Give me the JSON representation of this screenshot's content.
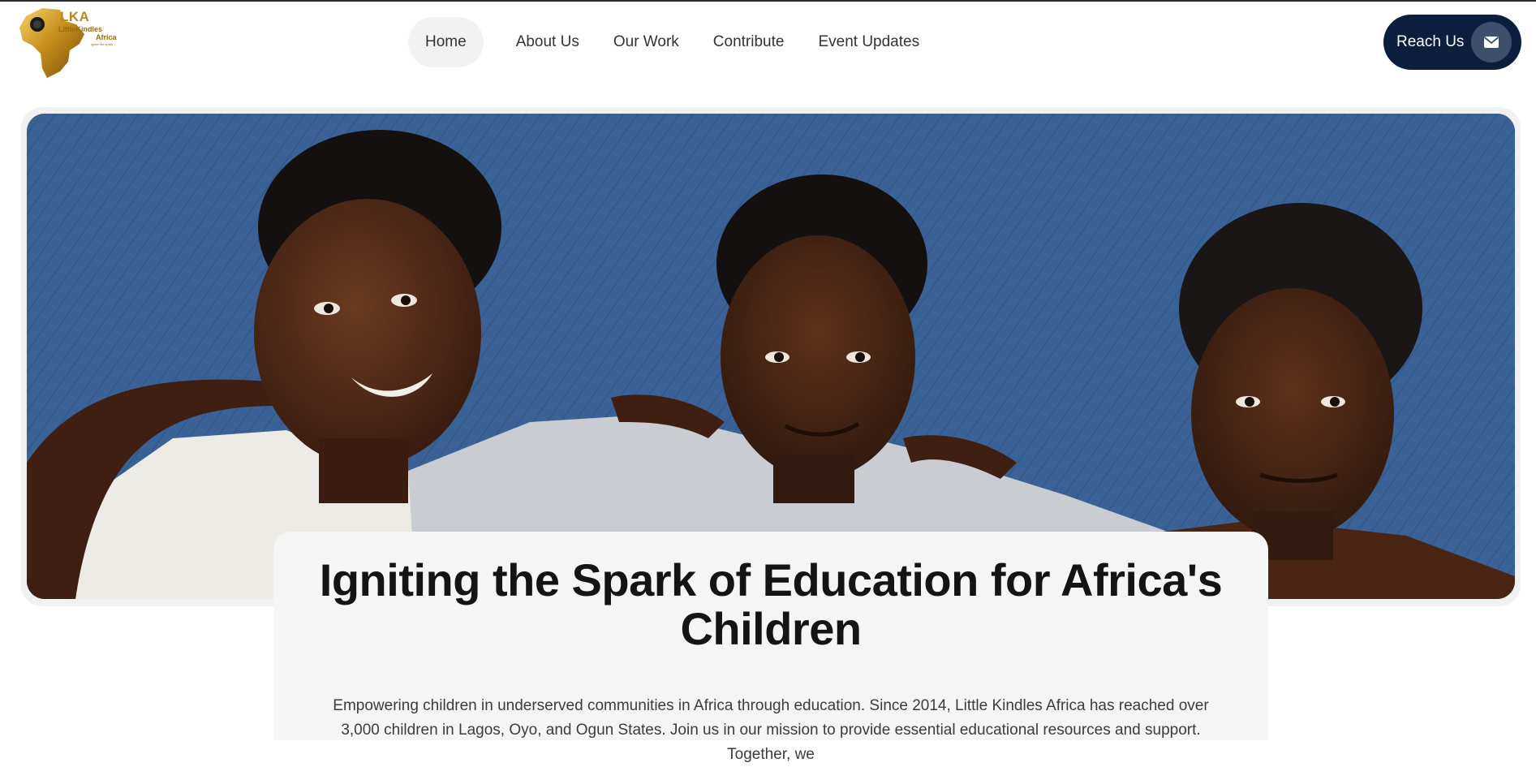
{
  "logo": {
    "abbr": "LKA",
    "name_line1": "LittleKindles",
    "name_line2": "Africa",
    "tagline": "ignite the spark"
  },
  "nav": {
    "items": [
      {
        "label": "Home",
        "active": true
      },
      {
        "label": "About Us",
        "active": false
      },
      {
        "label": "Our Work",
        "active": false
      },
      {
        "label": "Contribute",
        "active": false
      },
      {
        "label": "Event Updates",
        "active": false
      }
    ]
  },
  "cta": {
    "label": "Reach Us",
    "icon": "envelope-icon"
  },
  "hero": {
    "image": "three-smiling-children-blue-background"
  },
  "card": {
    "title": "Igniting the Spark of Education for Africa's Children",
    "text": "Empowering children in underserved communities in Africa through education. Since 2014, Little Kindles Africa has reached over 3,000 children in Lagos, Oyo, and Ogun States. Join us in our mission to provide essential educational resources and support. Together, we"
  },
  "colors": {
    "cta_bg": "#0b1e3d",
    "hero_bg": "#3b6296",
    "logo_gold": "#c9951e",
    "card_bg": "#f5f5f5"
  }
}
